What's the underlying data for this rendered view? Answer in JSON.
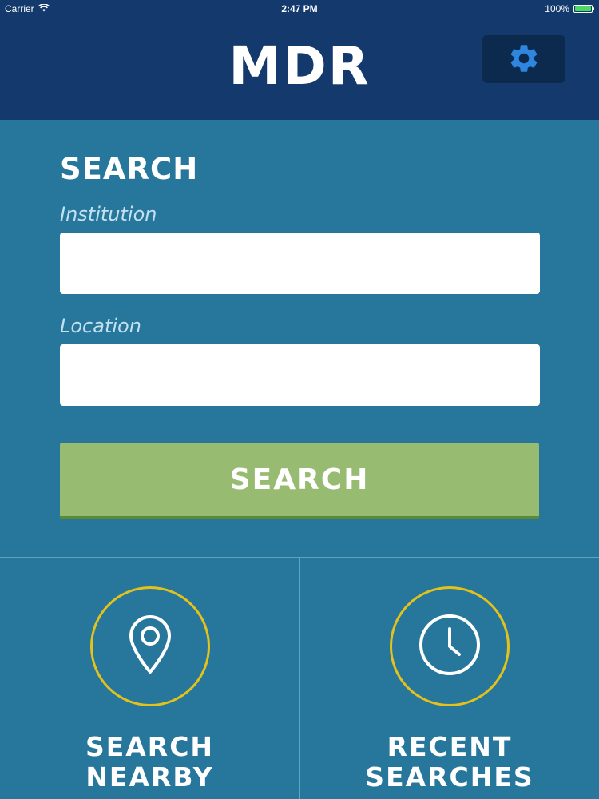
{
  "status_bar": {
    "carrier": "Carrier",
    "time": "2:47 PM",
    "battery": "100%",
    "battery_level": 1.0,
    "battery_color": "#4cd964"
  },
  "header": {
    "title": "MDR",
    "settings_icon": "gear-icon",
    "background": "#13396d"
  },
  "search_form": {
    "section_title": "SEARCH",
    "institution_label": "Institution",
    "institution_value": "",
    "location_label": "Location",
    "location_value": "",
    "search_button_label": "SEARCH",
    "button_color": "#97bb71"
  },
  "tiles": {
    "nearby": {
      "icon": "map-pin-icon",
      "label_line1": "SEARCH",
      "label_line2": "NEARBY"
    },
    "recent": {
      "icon": "clock-icon",
      "label_line1": "RECENT",
      "label_line2": "SEARCHES"
    },
    "ring_color": "#e3c21b"
  },
  "colors": {
    "background": "#27769b",
    "accent_gear": "#2e86de"
  }
}
